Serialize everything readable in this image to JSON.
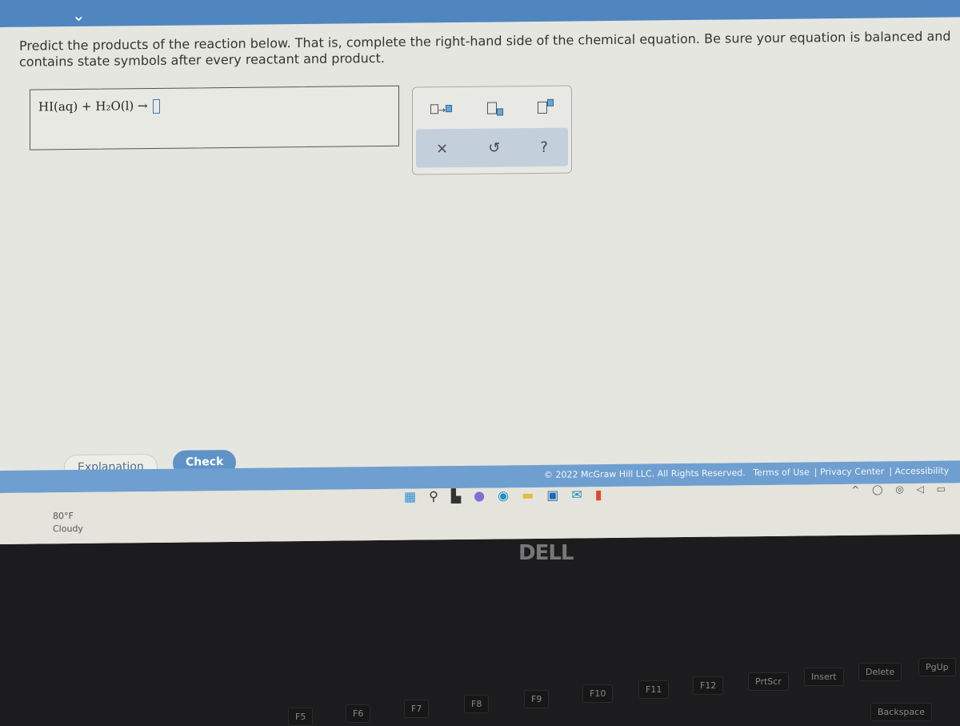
{
  "question": {
    "prompt": "Predict the products of the reaction below. That is, complete the right-hand side of the chemical equation. Be sure your equation is balanced and contains state symbols after every reactant and product.",
    "equation_left": "HI(aq) + H₂O(l) →"
  },
  "toolbar": {
    "reaction_arrow": "□→□",
    "subscript": "□₀",
    "superscript": "□⁰",
    "clear": "×",
    "undo": "↺",
    "help": "?"
  },
  "buttons": {
    "explanation": "Explanation",
    "check": "Check"
  },
  "footer": {
    "copyright": "© 2022 McGraw Hill LLC. All Rights Reserved.",
    "terms": "Terms of Use",
    "privacy": "Privacy Center",
    "accessibility": "Accessibility"
  },
  "weather": {
    "temp": "80°F",
    "condition": "Cloudy"
  },
  "brand": "DELL",
  "keys": [
    "F5",
    "F6",
    "F7",
    "F8",
    "F9",
    "F10",
    "F11",
    "F12",
    "PrtScr",
    "Insert",
    "Delete",
    "PgUp",
    "Backspace"
  ]
}
